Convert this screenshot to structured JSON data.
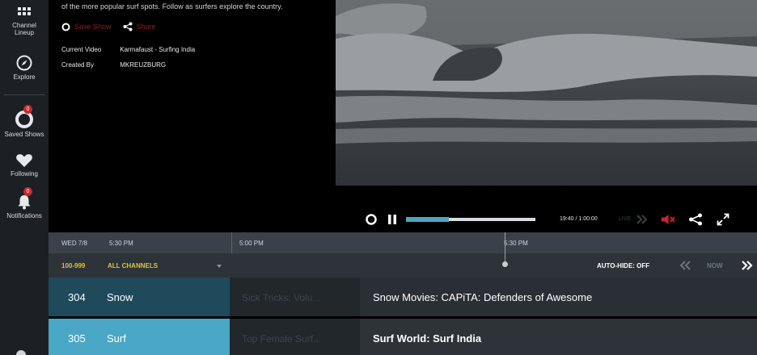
{
  "sidebar": {
    "items": [
      {
        "label": "Channel\nLineup",
        "icon": "grid-icon"
      },
      {
        "label": "Explore",
        "icon": "compass-icon"
      },
      {
        "label": "Saved Shows",
        "icon": "saved-shows-icon",
        "badge": "0"
      },
      {
        "label": "Following",
        "icon": "heart-icon"
      },
      {
        "label": "Notifications",
        "icon": "bell-icon",
        "badge": "0"
      }
    ]
  },
  "info": {
    "description": "of the more popular surf spots. Follow as surfers explore the country.",
    "save_show": "Save Show",
    "share": "Share",
    "current_video_label": "Current Video",
    "current_video_value": "Karmafaust - Surfing India",
    "created_by_label": "Created By",
    "created_by_value": "MKREUZBURG"
  },
  "player": {
    "time": "19:40 / 1:00:00",
    "live": "LIVE",
    "progress": 0.33,
    "buffer": 1.0
  },
  "guide": {
    "date": "WED 7/8",
    "times": [
      "5:30 PM",
      "5:00 PM",
      "5:30 PM"
    ],
    "range": "100-999",
    "all_channels": "ALL CHANNELS",
    "auto_hide": "AUTO-HIDE: OFF",
    "now": "NOW",
    "rows": [
      {
        "number": "304",
        "name": "Snow",
        "past": "Sick Tricks: Volu...",
        "current": "Snow Movies: CAPiTA: Defenders of Awesome"
      },
      {
        "number": "305",
        "name": "Surf",
        "past": "Top Female Surf...",
        "current": "Surf World: Surf India"
      }
    ]
  },
  "colors": {
    "accent": "#4aa7c6",
    "row_selected": "#4aa7c6",
    "row_dark": "#1f4a5c",
    "highlight_yellow": "#d9c542",
    "mute_red": "#c8262d"
  }
}
